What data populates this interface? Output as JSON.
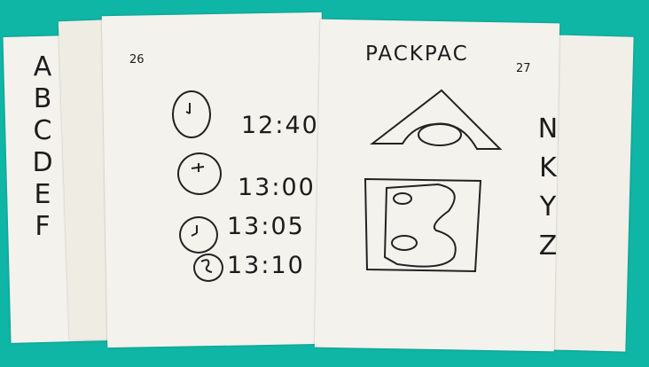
{
  "left_page": {
    "page_number": "26",
    "edge_letters": [
      "A",
      "B",
      "C",
      "D",
      "E",
      "F"
    ],
    "times": [
      "12:40",
      "13:00",
      "13:05",
      "13:10"
    ]
  },
  "right_page": {
    "page_number": "27",
    "title": "PACKPAC",
    "edge_letters": [
      "N",
      "K",
      "Y",
      "Z"
    ]
  },
  "colors": {
    "background": "#0fb5a5",
    "paper": "#f4f2ec",
    "ink": "#1c1c1c"
  }
}
